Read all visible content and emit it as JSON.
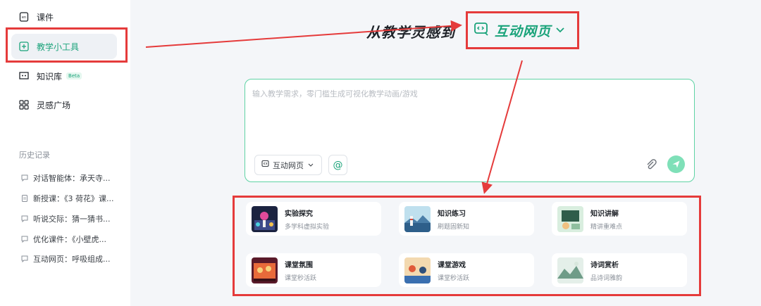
{
  "sidebar": {
    "nav": [
      {
        "label": "课件",
        "icon": "courseware-icon"
      },
      {
        "label": "教学小工具",
        "icon": "teaching-tools-icon"
      },
      {
        "label": "知识库",
        "icon": "knowledge-base-icon",
        "badge": "Beta"
      },
      {
        "label": "灵感广场",
        "icon": "grid-icon"
      }
    ],
    "history_title": "历史记录",
    "history": [
      {
        "label": "对话智能体：承天寺...",
        "icon": "chat-icon"
      },
      {
        "label": "新授课：《3 荷花》课...",
        "icon": "document-icon"
      },
      {
        "label": "听说交际：猜一猜书...",
        "icon": "chat-icon"
      },
      {
        "label": "优化课件：《小壁虎...",
        "icon": "chat-icon"
      },
      {
        "label": "互动网页：呼吸组成...",
        "icon": "chat-icon"
      }
    ]
  },
  "main": {
    "headline": "从教学灵感到",
    "mode_label": "互动网页",
    "input": {
      "placeholder": "输入教学需求，零门槛生成可视化教学动画/游戏",
      "value": "",
      "type_button_label": "互动网页",
      "at_label": "@"
    },
    "cards": [
      {
        "title": "实验探究",
        "subtitle": "多学科虚拟实验",
        "icon": "lab-thumbnail"
      },
      {
        "title": "知识练习",
        "subtitle": "刷题固新知",
        "icon": "lighthouse-thumbnail"
      },
      {
        "title": "知识讲解",
        "subtitle": "精讲重难点",
        "icon": "classroom-thumbnail"
      },
      {
        "title": "课堂氛围",
        "subtitle": "课堂秒活跃",
        "icon": "stage-thumbnail"
      },
      {
        "title": "课堂游戏",
        "subtitle": "课堂秒活跃",
        "icon": "game-thumbnail"
      },
      {
        "title": "诗词赏析",
        "subtitle": "品诗词雅韵",
        "icon": "poetry-thumbnail"
      }
    ]
  },
  "colors": {
    "accent": "#1aa37a",
    "annotation": "#e53b3b",
    "background": "#f4f6f9"
  }
}
